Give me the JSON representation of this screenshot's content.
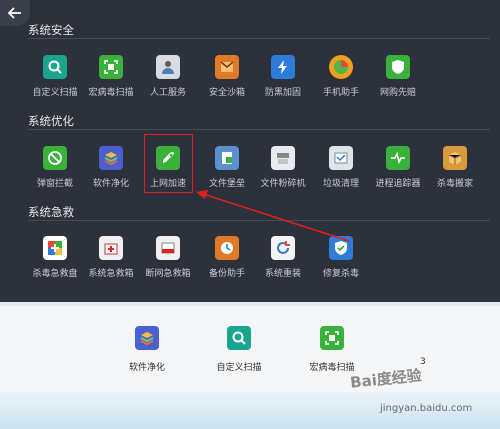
{
  "sections": {
    "security": {
      "title": "系统安全",
      "tools": [
        "自定义扫描",
        "宏病毒扫描",
        "人工服务",
        "安全沙箱",
        "防黑加固",
        "手机助手",
        "网购先赔"
      ]
    },
    "optimize": {
      "title": "系统优化",
      "tools": [
        "弹窗拦截",
        "软件净化",
        "上网加速",
        "文件堡垒",
        "文件粉碎机",
        "垃圾清理",
        "进程追踪器",
        "杀毒搬家"
      ]
    },
    "rescue": {
      "title": "系统急救",
      "tools": [
        "杀毒急救盘",
        "系统急救箱",
        "断网急救箱",
        "备份助手",
        "系统重装",
        "修复杀毒"
      ]
    }
  },
  "quicklaunch": {
    "items": [
      "软件净化",
      "自定义扫描",
      "宏病毒扫描"
    ],
    "count": "3"
  },
  "watermark": {
    "logo": "Bai度经验",
    "url": "jingyan.baidu.com"
  },
  "colors": {
    "highlight": "#e02020",
    "background": "#2d313c"
  }
}
